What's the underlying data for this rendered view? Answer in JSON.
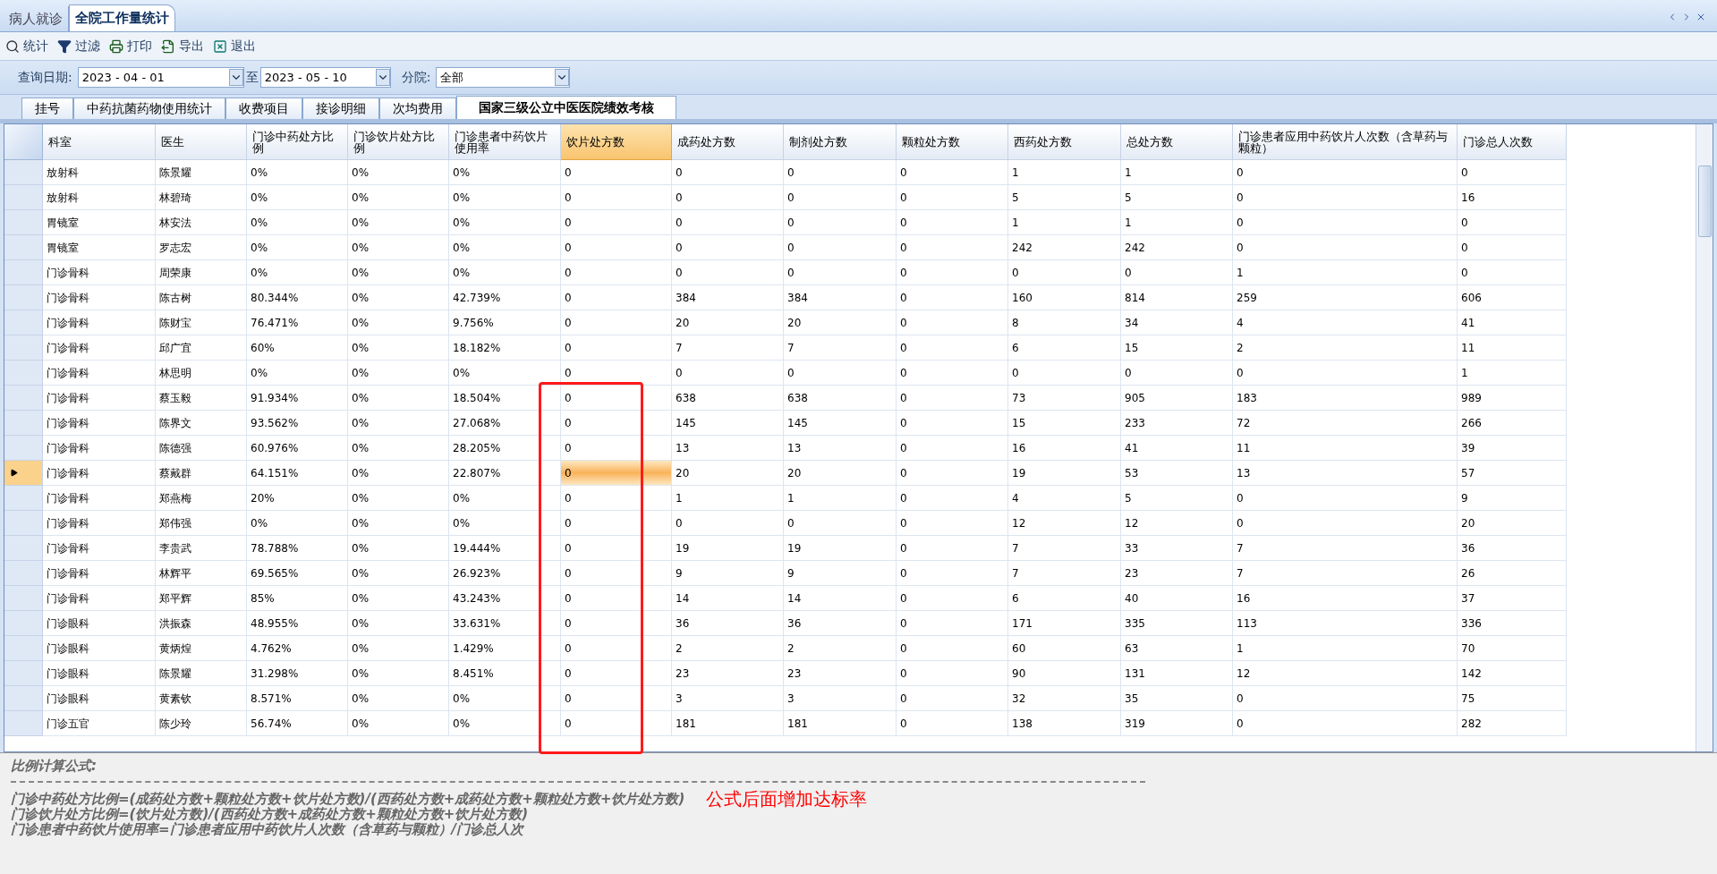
{
  "doc_tabs": [
    {
      "label": "病人就诊",
      "selected": false
    },
    {
      "label": "全院工作量统计",
      "selected": true
    }
  ],
  "toolbar": [
    {
      "kind": "search",
      "label": "统计"
    },
    {
      "kind": "filter",
      "label": "过滤"
    },
    {
      "kind": "print",
      "label": "打印"
    },
    {
      "kind": "export",
      "label": "导出"
    },
    {
      "kind": "exit",
      "label": "退出"
    }
  ],
  "query": {
    "date_label": "查询日期:",
    "start": "2023 - 04 - 01",
    "to_label": "至",
    "end": "2023 - 05 - 10",
    "branch_label": "分院:",
    "branch": "全部"
  },
  "tabs": [
    {
      "label": "挂号",
      "selected": false
    },
    {
      "label": "中药抗菌药物使用统计",
      "selected": false
    },
    {
      "label": "收费项目",
      "selected": false
    },
    {
      "label": "接诊明细",
      "selected": false
    },
    {
      "label": "次均费用",
      "selected": false
    },
    {
      "label": "国家三级公立中医医院绩效考核",
      "selected": true
    }
  ],
  "table": {
    "columns": [
      {
        "label": "科室",
        "selected": false
      },
      {
        "label": "医生",
        "selected": false
      },
      {
        "label": "门诊中药处方比例",
        "selected": false
      },
      {
        "label": "门诊饮片处方比例",
        "selected": false
      },
      {
        "label": "门诊患者中药饮片使用率",
        "selected": false
      },
      {
        "label": "饮片处方数",
        "selected": true
      },
      {
        "label": "成药处方数",
        "selected": false
      },
      {
        "label": "制剂处方数",
        "selected": false
      },
      {
        "label": "颗粒处方数",
        "selected": false
      },
      {
        "label": "西药处方数",
        "selected": false
      },
      {
        "label": "总处方数",
        "selected": false
      },
      {
        "label": "门诊患者应用中药饮片人次数（含草药与颗粒）",
        "selected": false
      },
      {
        "label": "门诊总人次数",
        "selected": false
      }
    ],
    "rows": [
      {
        "selected": false,
        "cells": [
          "放射科",
          "陈景耀",
          "0%",
          "0%",
          "0%",
          "0",
          "0",
          "0",
          "0",
          "1",
          "1",
          "0",
          "0"
        ]
      },
      {
        "selected": false,
        "cells": [
          "放射科",
          "林碧琦",
          "0%",
          "0%",
          "0%",
          "0",
          "0",
          "0",
          "0",
          "5",
          "5",
          "0",
          "16"
        ]
      },
      {
        "selected": false,
        "cells": [
          "胃镜室",
          "林安法",
          "0%",
          "0%",
          "0%",
          "0",
          "0",
          "0",
          "0",
          "1",
          "1",
          "0",
          "0"
        ]
      },
      {
        "selected": false,
        "cells": [
          "胃镜室",
          "罗志宏",
          "0%",
          "0%",
          "0%",
          "0",
          "0",
          "0",
          "0",
          "242",
          "242",
          "0",
          "0"
        ]
      },
      {
        "selected": false,
        "cells": [
          "门诊骨科",
          "周荣康",
          "0%",
          "0%",
          "0%",
          "0",
          "0",
          "0",
          "0",
          "0",
          "0",
          "1",
          "0"
        ]
      },
      {
        "selected": false,
        "cells": [
          "门诊骨科",
          "陈古树",
          "80.344%",
          "0%",
          "42.739%",
          "0",
          "384",
          "384",
          "0",
          "160",
          "814",
          "259",
          "606"
        ]
      },
      {
        "selected": false,
        "cells": [
          "门诊骨科",
          "陈财宝",
          "76.471%",
          "0%",
          "9.756%",
          "0",
          "20",
          "20",
          "0",
          "8",
          "34",
          "4",
          "41"
        ]
      },
      {
        "selected": false,
        "cells": [
          "门诊骨科",
          "邱广宜",
          "60%",
          "0%",
          "18.182%",
          "0",
          "7",
          "7",
          "0",
          "6",
          "15",
          "2",
          "11"
        ]
      },
      {
        "selected": false,
        "cells": [
          "门诊骨科",
          "林思明",
          "0%",
          "0%",
          "0%",
          "0",
          "0",
          "0",
          "0",
          "0",
          "0",
          "0",
          "1"
        ]
      },
      {
        "selected": false,
        "cells": [
          "门诊骨科",
          "蔡玉毅",
          "91.934%",
          "0%",
          "18.504%",
          "0",
          "638",
          "638",
          "0",
          "73",
          "905",
          "183",
          "989"
        ]
      },
      {
        "selected": false,
        "cells": [
          "门诊骨科",
          "陈界文",
          "93.562%",
          "0%",
          "27.068%",
          "0",
          "145",
          "145",
          "0",
          "15",
          "233",
          "72",
          "266"
        ]
      },
      {
        "selected": false,
        "cells": [
          "门诊骨科",
          "陈德强",
          "60.976%",
          "0%",
          "28.205%",
          "0",
          "13",
          "13",
          "0",
          "16",
          "41",
          "11",
          "39"
        ]
      },
      {
        "selected": true,
        "cells": [
          "门诊骨科",
          "蔡戴群",
          "64.151%",
          "0%",
          "22.807%",
          "0",
          "20",
          "20",
          "0",
          "19",
          "53",
          "13",
          "57"
        ]
      },
      {
        "selected": false,
        "cells": [
          "门诊骨科",
          "郑燕梅",
          "20%",
          "0%",
          "0%",
          "0",
          "1",
          "1",
          "0",
          "4",
          "5",
          "0",
          "9"
        ]
      },
      {
        "selected": false,
        "cells": [
          "门诊骨科",
          "郑伟强",
          "0%",
          "0%",
          "0%",
          "0",
          "0",
          "0",
          "0",
          "12",
          "12",
          "0",
          "20"
        ]
      },
      {
        "selected": false,
        "cells": [
          "门诊骨科",
          "李贵武",
          "78.788%",
          "0%",
          "19.444%",
          "0",
          "19",
          "19",
          "0",
          "7",
          "33",
          "7",
          "36"
        ]
      },
      {
        "selected": false,
        "cells": [
          "门诊骨科",
          "林辉平",
          "69.565%",
          "0%",
          "26.923%",
          "0",
          "9",
          "9",
          "0",
          "7",
          "23",
          "7",
          "26"
        ]
      },
      {
        "selected": false,
        "cells": [
          "门诊骨科",
          "郑平辉",
          "85%",
          "0%",
          "43.243%",
          "0",
          "14",
          "14",
          "0",
          "6",
          "40",
          "16",
          "37"
        ]
      },
      {
        "selected": false,
        "cells": [
          "门诊眼科",
          "洪振森",
          "48.955%",
          "0%",
          "33.631%",
          "0",
          "36",
          "36",
          "0",
          "171",
          "335",
          "113",
          "336"
        ]
      },
      {
        "selected": false,
        "cells": [
          "门诊眼科",
          "黄炳煌",
          "4.762%",
          "0%",
          "1.429%",
          "0",
          "2",
          "2",
          "0",
          "60",
          "63",
          "1",
          "70"
        ]
      },
      {
        "selected": false,
        "cells": [
          "门诊眼科",
          "陈景耀",
          "31.298%",
          "0%",
          "8.451%",
          "0",
          "23",
          "23",
          "0",
          "90",
          "131",
          "12",
          "142"
        ]
      },
      {
        "selected": false,
        "cells": [
          "门诊眼科",
          "黄素钦",
          "8.571%",
          "0%",
          "0%",
          "0",
          "3",
          "3",
          "0",
          "32",
          "35",
          "0",
          "75"
        ]
      },
      {
        "selected": false,
        "cells": [
          "门诊五官",
          "陈少玲",
          "56.74%",
          "0%",
          "0%",
          "0",
          "181",
          "181",
          "0",
          "138",
          "319",
          "0",
          "282"
        ]
      }
    ]
  },
  "formula": {
    "title": "比例计算公式:",
    "lines": [
      "门诊中药处方比例=(成药处方数+颗粒处方数+饮片处方数)/(西药处方数+成药处方数+颗粒处方数+饮片处方数)",
      "门诊饮片处方比例=(饮片处方数)/(西药处方数+成药处方数+颗粒处方数+饮片处方数)",
      "门诊患者中药饮片使用率=门诊患者应用中药饮片人次数（含草药与颗粒）/门诊总人次"
    ],
    "note": "公式后面增加达标率"
  }
}
